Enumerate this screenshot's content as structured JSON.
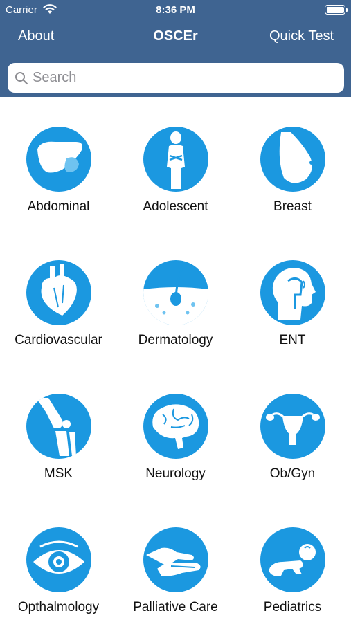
{
  "status": {
    "carrier": "Carrier",
    "time": "8:36 PM"
  },
  "nav": {
    "left": "About",
    "title": "OSCEr",
    "right": "Quick Test"
  },
  "search": {
    "placeholder": "Search"
  },
  "topics": [
    {
      "label": "Abdominal",
      "icon": "liver-icon"
    },
    {
      "label": "Adolescent",
      "icon": "adolescent-icon"
    },
    {
      "label": "Breast",
      "icon": "breast-icon"
    },
    {
      "label": "Cardiovascular",
      "icon": "heart-icon"
    },
    {
      "label": "Dermatology",
      "icon": "skin-hair-icon"
    },
    {
      "label": "ENT",
      "icon": "head-profile-icon"
    },
    {
      "label": "MSK",
      "icon": "knee-joint-icon"
    },
    {
      "label": "Neurology",
      "icon": "brain-icon"
    },
    {
      "label": "Ob/Gyn",
      "icon": "uterus-icon"
    },
    {
      "label": "Opthalmology",
      "icon": "eye-icon"
    },
    {
      "label": "Palliative Care",
      "icon": "holding-hands-icon"
    },
    {
      "label": "Pediatrics",
      "icon": "baby-icon"
    }
  ],
  "colors": {
    "header": "#3f6491",
    "icon_circle": "#1b98e0",
    "icon_fg": "#ffffff",
    "background": "#ffffff"
  }
}
